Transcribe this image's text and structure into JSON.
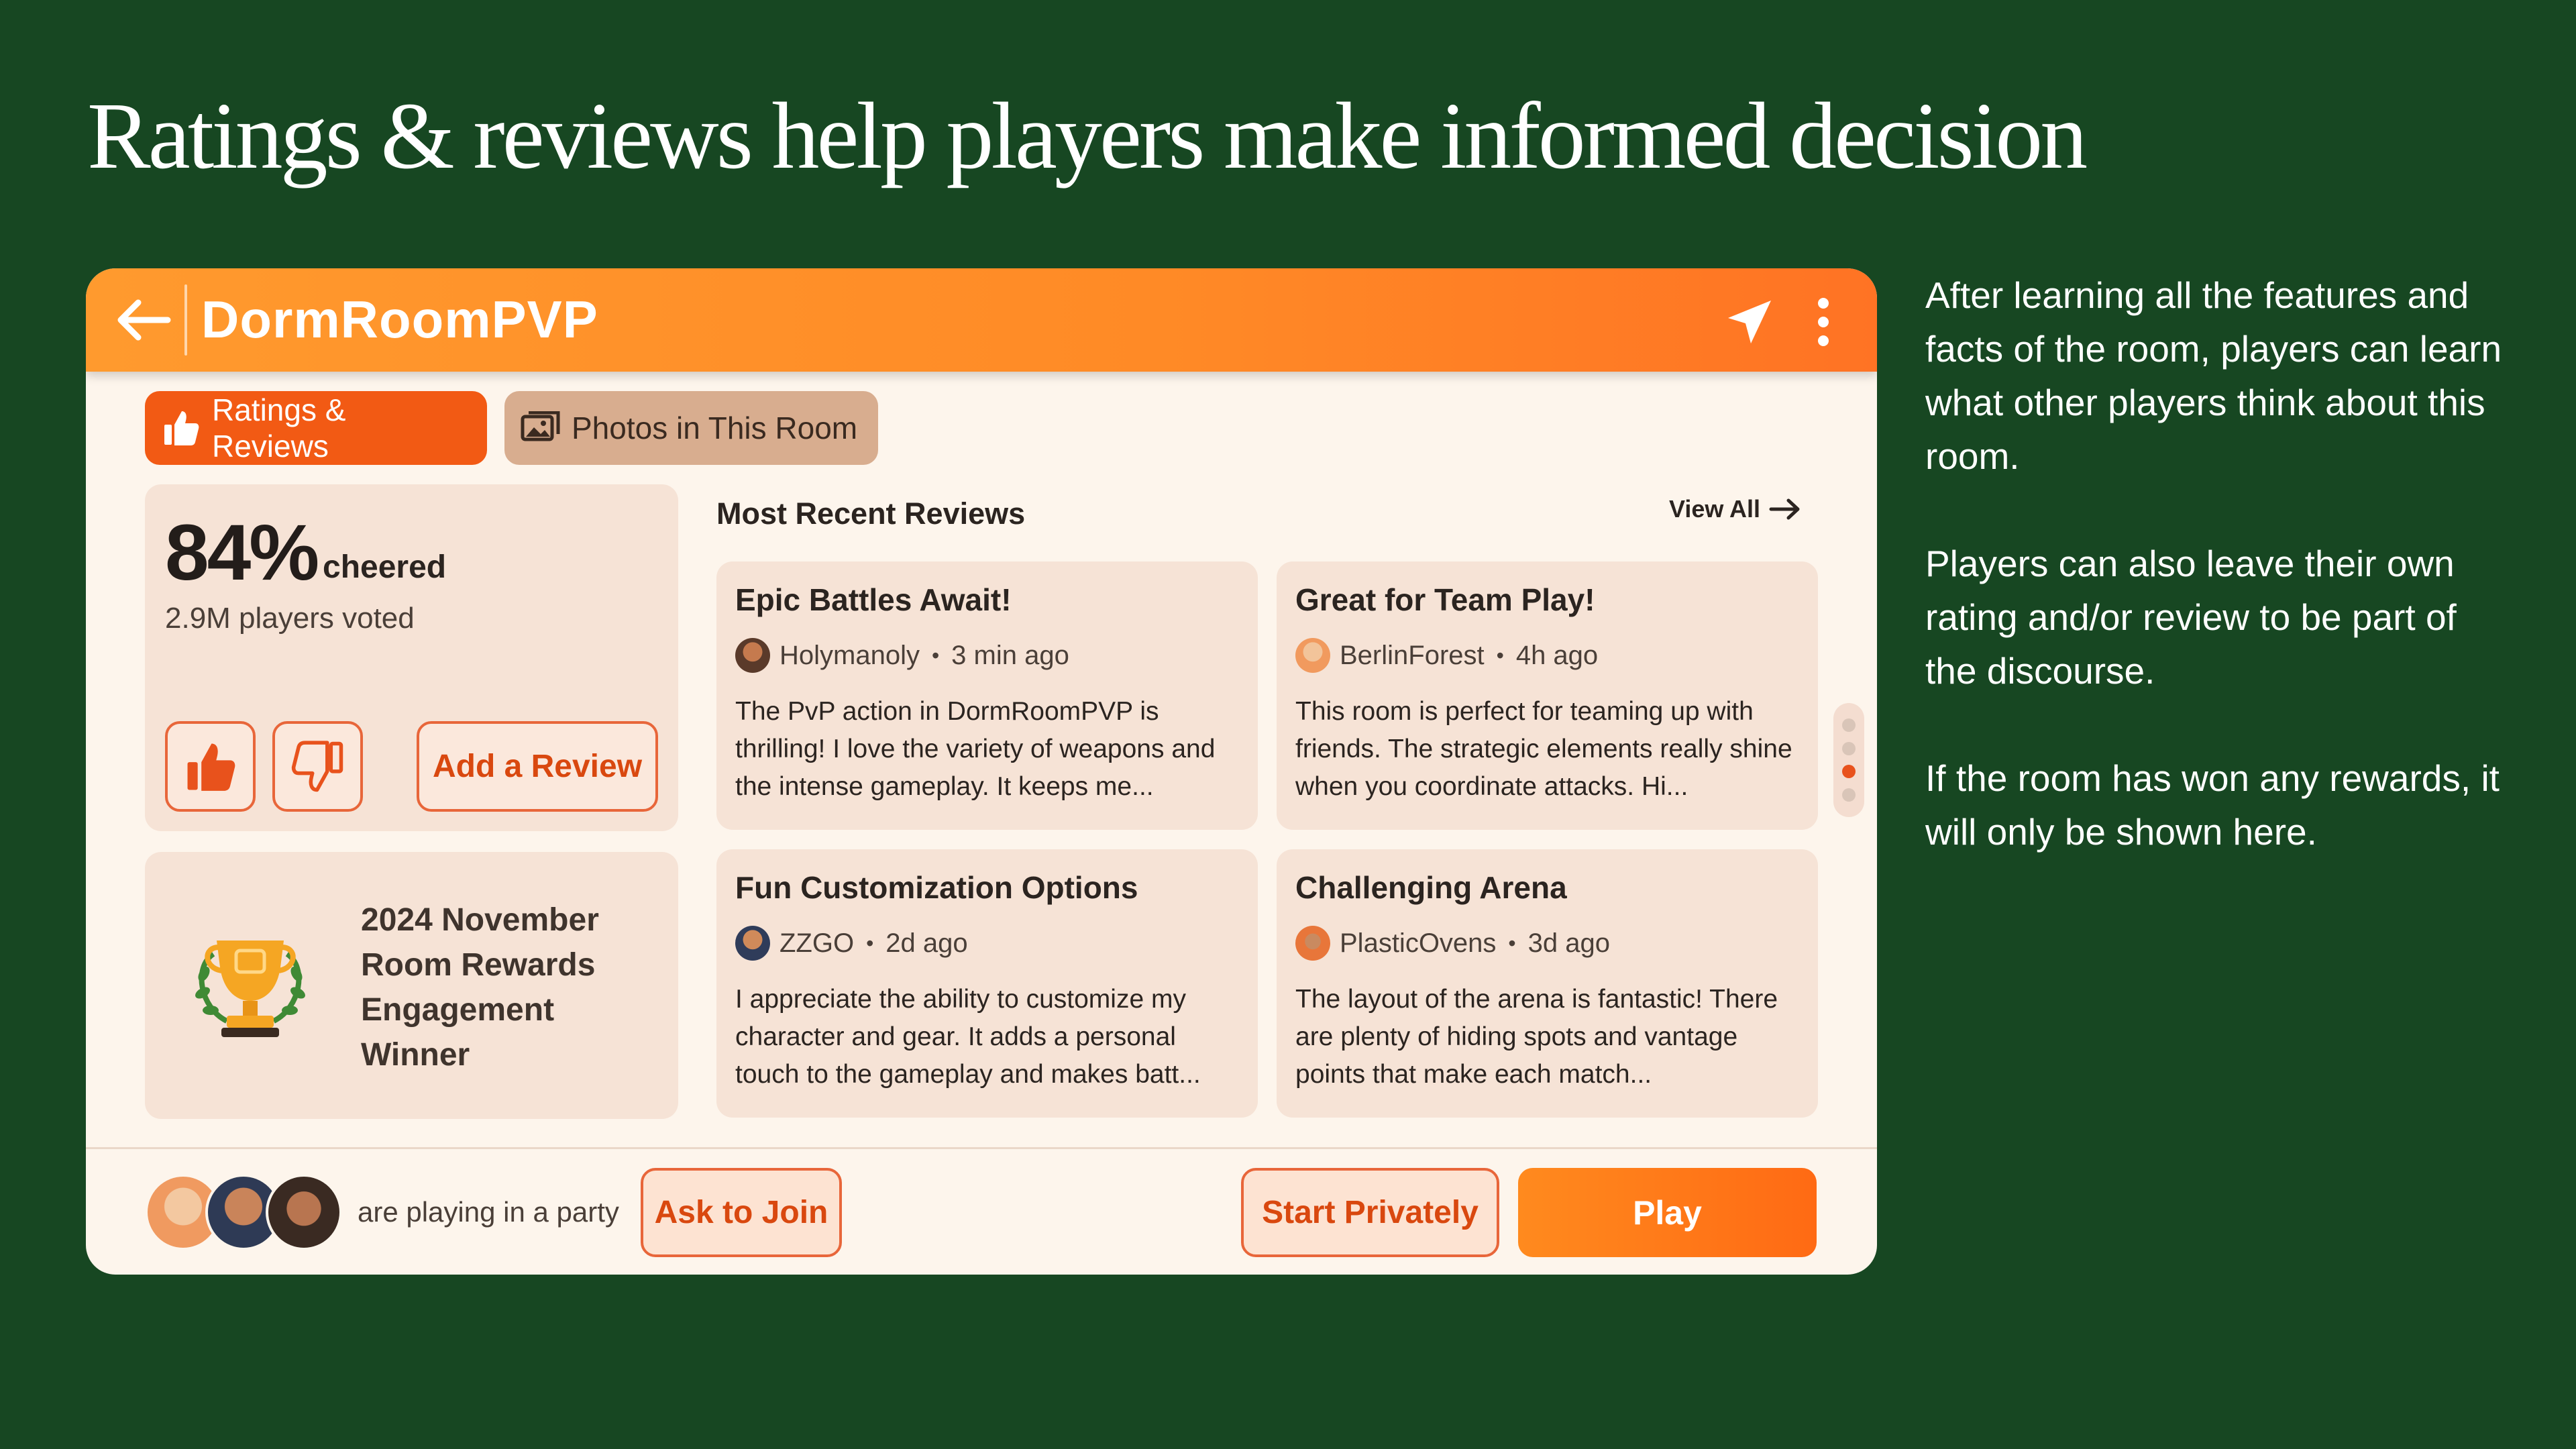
{
  "slide": {
    "title": "Ratings & reviews help players make informed decision",
    "side_paragraphs": [
      "After learning all the features and facts of the room, players can learn what other players think about this room.",
      "Players can also leave their own rating and/or review to be part of the discourse.",
      "If the room has won any rewards, it will only be shown here."
    ]
  },
  "app": {
    "room_title": "DormRoomPVP",
    "icons": {
      "back": "arrow-left-icon",
      "share": "send-icon",
      "more": "more-vertical-icon"
    },
    "tabs": [
      {
        "label": "Ratings & Reviews",
        "icon": "thumbs-up-icon",
        "active": true
      },
      {
        "label": "Photos in This Room",
        "icon": "photos-icon",
        "active": false
      }
    ],
    "score": {
      "value": "84%",
      "suffix": "cheered",
      "votes": "2.9M players voted",
      "add_review_label": "Add a Review"
    },
    "award": {
      "icon": "trophy-icon",
      "lines": [
        "2024 November",
        "Room Rewards",
        "Engagement",
        "Winner"
      ]
    },
    "reviews_header": "Most Recent Reviews",
    "view_all_label": "View All",
    "reviews": [
      {
        "title": "Epic Battles Await!",
        "author": "Holymanoly",
        "time": "3 min ago",
        "text": "The PvP action in DormRoomPVP is thrilling! I love the variety of weapons and the intense gameplay. It keeps me..."
      },
      {
        "title": "Great for Team Play!",
        "author": "BerlinForest",
        "time": "4h ago",
        "text": "This room is perfect for teaming up with friends. The strategic elements really shine when you coordinate attacks. Hi..."
      },
      {
        "title": "Fun Customization Options",
        "author": "ZZGO",
        "time": "2d ago",
        "text": "I appreciate the ability to customize my character and gear. It adds a personal touch to the gameplay and makes batt..."
      },
      {
        "title": "Challenging Arena",
        "author": "PlasticOvens",
        "time": "3d ago",
        "text": "The layout of the arena is fantastic! There are plenty of hiding spots and vantage points that make each match..."
      }
    ],
    "party_text": "are playing in a party",
    "ask_join_label": "Ask to Join",
    "start_privately_label": "Start Privately",
    "play_label": "Play",
    "colors": {
      "background": "#174722",
      "accent": "#ff7a1f",
      "panel": "#fdf5ec",
      "card": "#f6e3d6"
    }
  }
}
